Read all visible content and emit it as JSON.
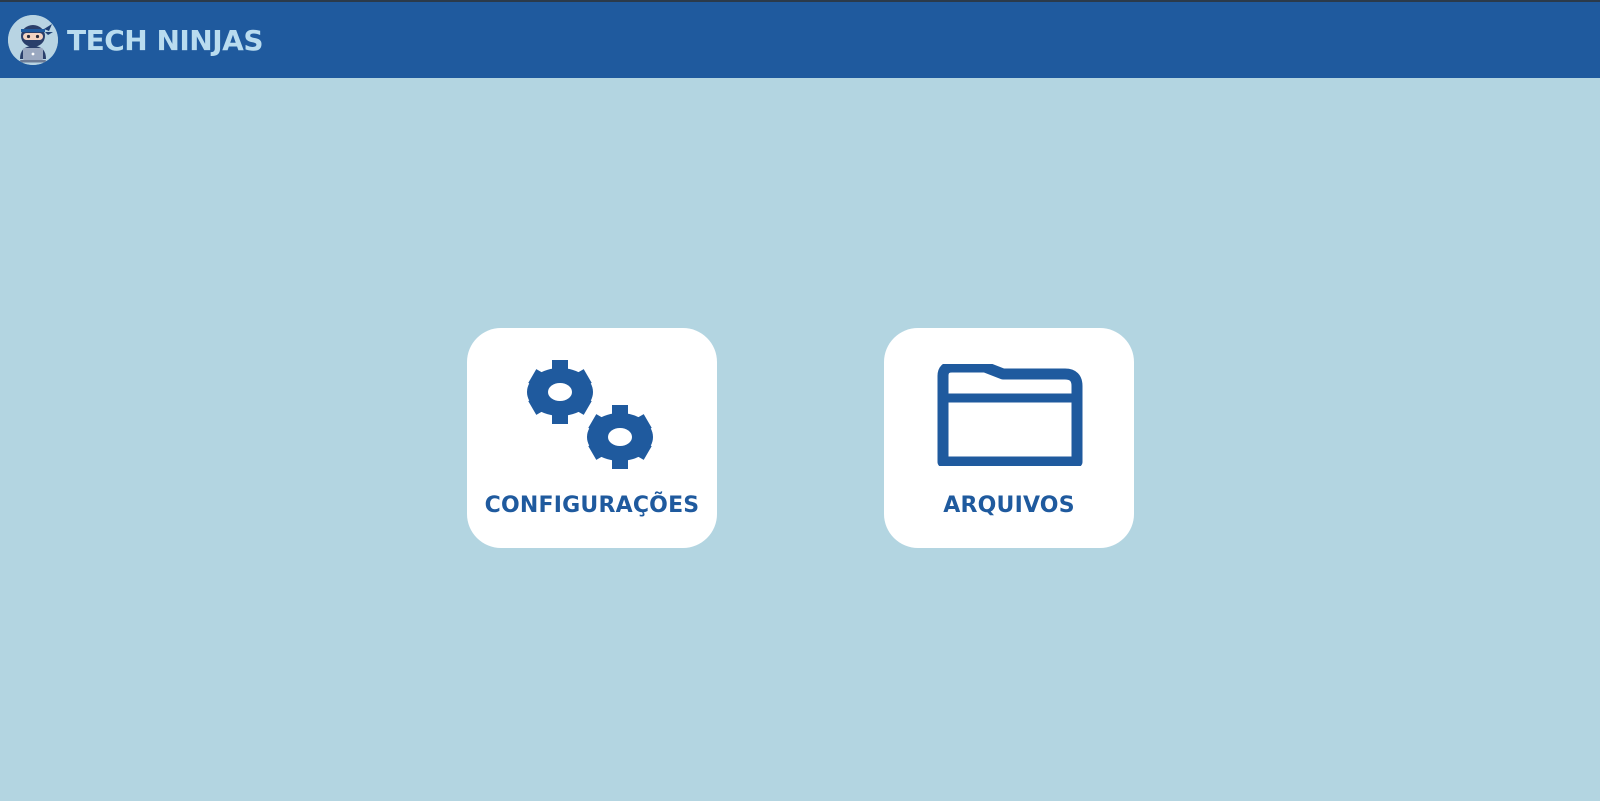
{
  "app": {
    "brand": "TECH NINJAS",
    "logo_icon": "ninja-laptop-icon"
  },
  "colors": {
    "header": "#1f5a9e",
    "background": "#b3d5e1",
    "accent": "#1f5a9e",
    "brand_text": "#b9dcef",
    "tile": "#ffffff"
  },
  "tiles": [
    {
      "label": "CONFIGURAÇÕES",
      "icon": "gears-icon"
    },
    {
      "label": "ARQUIVOS",
      "icon": "folder-icon"
    }
  ]
}
